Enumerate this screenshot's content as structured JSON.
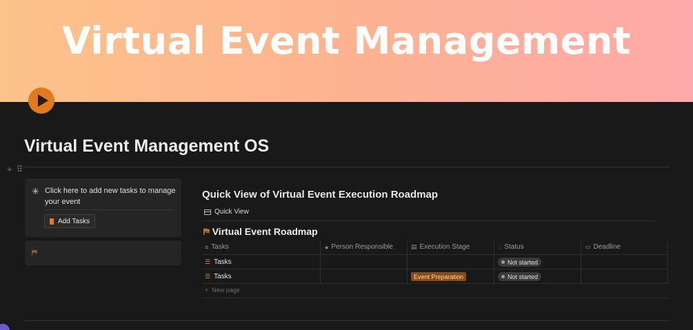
{
  "cover": {
    "title": "Virtual Event Management"
  },
  "page": {
    "title": "Virtual Event Management OS"
  },
  "callout": {
    "text": "Click here to add new tasks to manage your event",
    "button_label": "Add Tasks"
  },
  "section": {
    "title": "Quick View of Virtual Event Execution Roadmap",
    "view_tab": "Quick View"
  },
  "database": {
    "title": "Virtual Event Roadmap",
    "columns": [
      "Tasks",
      "Person Responsible",
      "Execution Stage",
      "Status",
      "Deadline"
    ],
    "rows": [
      {
        "task": "Tasks",
        "person": "",
        "stage": "",
        "status": "Not started",
        "deadline": ""
      },
      {
        "task": "Tasks",
        "person": "",
        "stage": "Event Preparation",
        "status": "Not started",
        "deadline": ""
      }
    ],
    "new_page_label": "New page"
  },
  "colors": {
    "accent": "#e07a1f",
    "background": "#191919",
    "stage_tag": "#8a4a16"
  }
}
